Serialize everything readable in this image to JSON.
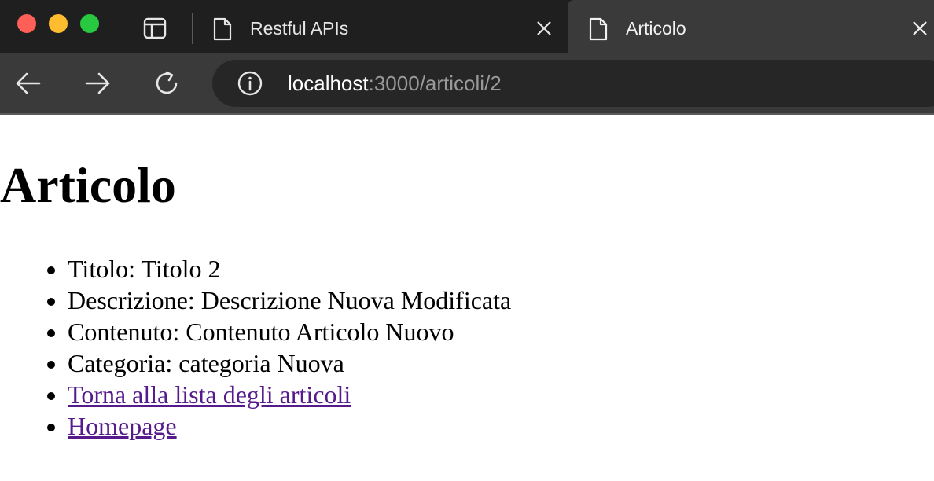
{
  "browser": {
    "tabs": [
      {
        "title": "Restful APIs",
        "active": false
      },
      {
        "title": "Articolo",
        "active": true
      }
    ],
    "address": {
      "host": "localhost",
      "rest": ":3000/articoli/2"
    },
    "colors": {
      "chrome_dark": "#1f1f1f",
      "toolbar": "#3a3a3a",
      "omnibox": "#262626",
      "traffic_red": "#fe5f57",
      "traffic_yellow": "#febc2e",
      "traffic_green": "#28c840",
      "visited_link": "#551a8b"
    },
    "icons": [
      "sidebar-toggle-icon",
      "document-icon",
      "close-icon",
      "back-arrow-icon",
      "forward-arrow-icon",
      "reload-icon",
      "info-icon"
    ]
  },
  "page": {
    "heading": "Articolo",
    "items": [
      "Titolo: Titolo 2",
      "Descrizione: Descrizione Nuova Modificata",
      "Contenuto: Contenuto Articolo Nuovo",
      "Categoria: categoria Nuova"
    ],
    "links": [
      "Torna alla lista degli articoli",
      "Homepage"
    ]
  }
}
